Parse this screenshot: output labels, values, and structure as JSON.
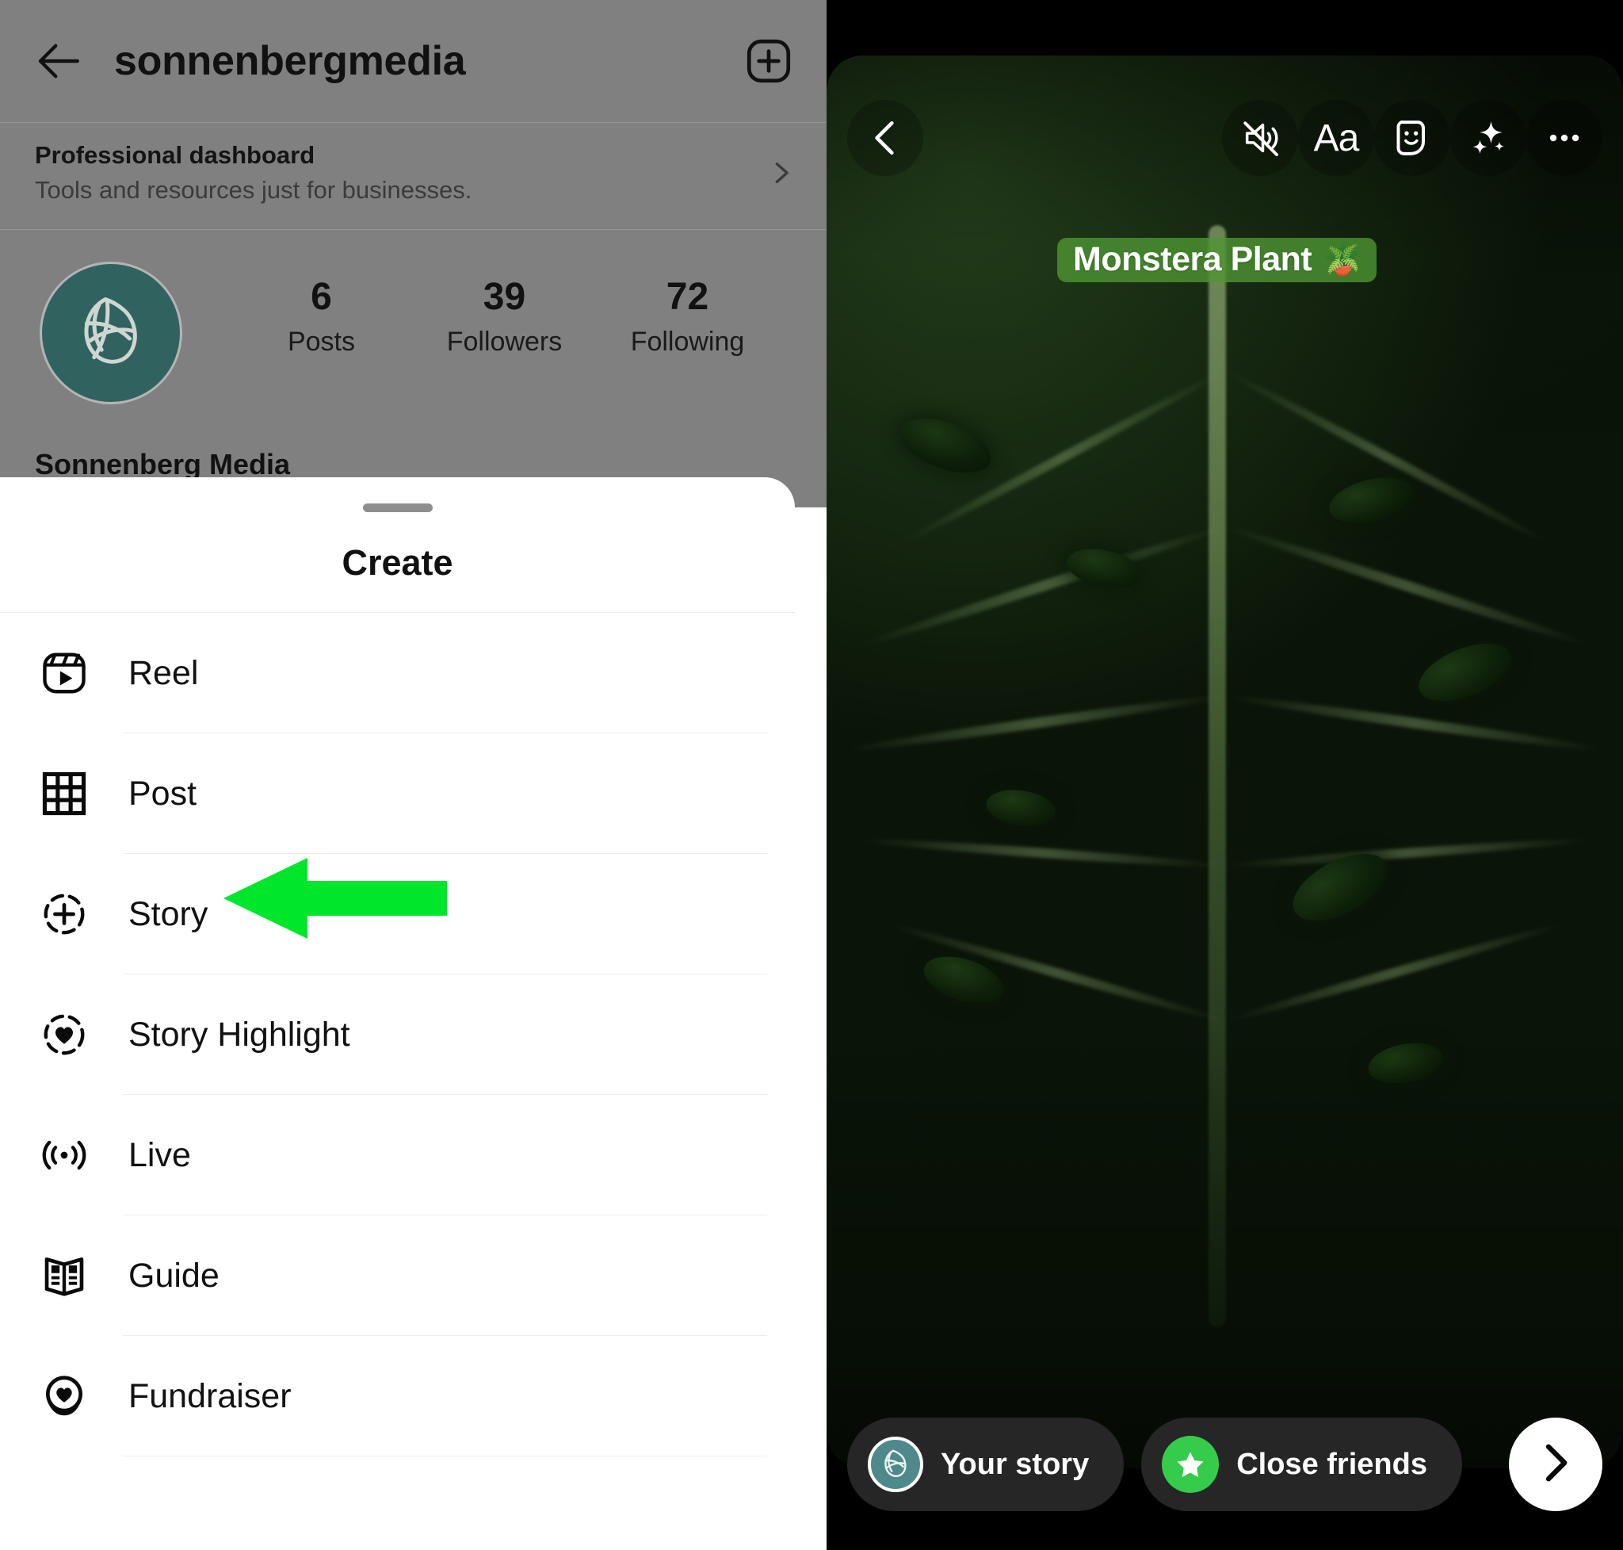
{
  "profile": {
    "username": "sonnenbergmedia",
    "display_name": "Sonnenberg Media",
    "back_icon": "back-arrow-icon",
    "add_icon": "plus-square-icon",
    "dashboard": {
      "title": "Professional dashboard",
      "subtitle": "Tools and resources just for businesses.",
      "chevron_icon": "chevron-right-icon"
    },
    "stats": [
      {
        "value": "6",
        "label": "Posts"
      },
      {
        "value": "39",
        "label": "Followers"
      },
      {
        "value": "72",
        "label": "Following"
      }
    ],
    "avatar_icon": "leaf-logo-icon",
    "avatar_color": "#30635f"
  },
  "create_sheet": {
    "title": "Create",
    "grabber": "drag-handle",
    "items": [
      {
        "label": "Reel",
        "icon": "reel-icon"
      },
      {
        "label": "Post",
        "icon": "grid-post-icon"
      },
      {
        "label": "Story",
        "icon": "story-plus-circle-icon"
      },
      {
        "label": "Story Highlight",
        "icon": "highlight-heart-circle-icon"
      },
      {
        "label": "Live",
        "icon": "live-broadcast-icon"
      },
      {
        "label": "Guide",
        "icon": "guide-book-icon"
      },
      {
        "label": "Fundraiser",
        "icon": "fundraiser-heart-icon"
      }
    ]
  },
  "annotation": {
    "arrow_icon": "green-left-arrow",
    "color": "#00e62a",
    "points_to": "Story"
  },
  "story_editor": {
    "toolbar": [
      {
        "icon": "back-chevron-icon",
        "label": "Back"
      },
      {
        "icon": "mute-audio-icon",
        "label": "Mute"
      },
      {
        "icon": "text-aa-icon",
        "label": "Aa"
      },
      {
        "icon": "sticker-smiley-icon",
        "label": "Stickers"
      },
      {
        "icon": "sparkles-effects-icon",
        "label": "Effects"
      },
      {
        "icon": "more-options-icon",
        "label": "More"
      }
    ],
    "text_sticker": {
      "text": "Monstera Plant",
      "emoji": "🪴",
      "background": "#4e9632"
    },
    "bottom_bar": {
      "your_story": {
        "label": "Your story",
        "avatar_icon": "leaf-logo-icon"
      },
      "close_friends": {
        "label": "Close friends",
        "icon": "green-star-icon",
        "color": "#35cc4b"
      },
      "next": {
        "icon": "chevron-right-icon",
        "label": "Next"
      }
    }
  }
}
